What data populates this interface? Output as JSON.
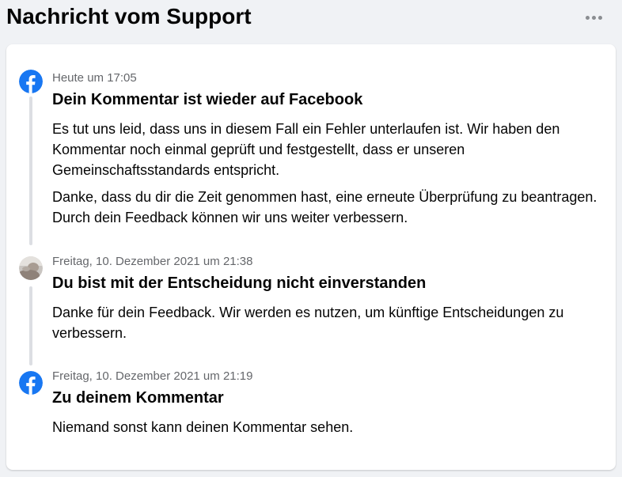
{
  "page": {
    "title": "Nachricht vom Support",
    "more_icon": "more-horizontal-icon"
  },
  "colors": {
    "facebook_blue": "#1877f2",
    "background": "#f0f2f5",
    "card": "#ffffff",
    "muted_text": "#65676b",
    "timeline": "#dcdee3"
  },
  "messages": [
    {
      "sender_icon": "facebook-logo-icon",
      "timestamp": "Heute um 17:05",
      "title": "Dein Kommentar ist wieder auf Facebook",
      "paragraphs": [
        "Es tut uns leid, dass uns in diesem Fall ein Fehler unterlaufen ist. Wir haben den Kommentar noch einmal geprüft und festgestellt, dass er unseren Gemeinschaftsstandards entspricht.",
        "Danke, dass du dir die Zeit genommen hast, eine erneute Überprüfung zu beantragen. Durch dein Feedback können wir uns weiter verbessern."
      ]
    },
    {
      "sender_icon": "user-avatar",
      "timestamp": "Freitag, 10. Dezember 2021 um 21:38",
      "title": "Du bist mit der Entscheidung nicht einverstanden",
      "paragraphs": [
        "Danke für dein Feedback. Wir werden es nutzen, um künftige Entscheidungen zu verbessern."
      ]
    },
    {
      "sender_icon": "facebook-logo-icon",
      "timestamp": "Freitag, 10. Dezember 2021 um 21:19",
      "title": "Zu deinem Kommentar",
      "paragraphs": [
        "Niemand sonst kann deinen Kommentar sehen."
      ]
    }
  ]
}
